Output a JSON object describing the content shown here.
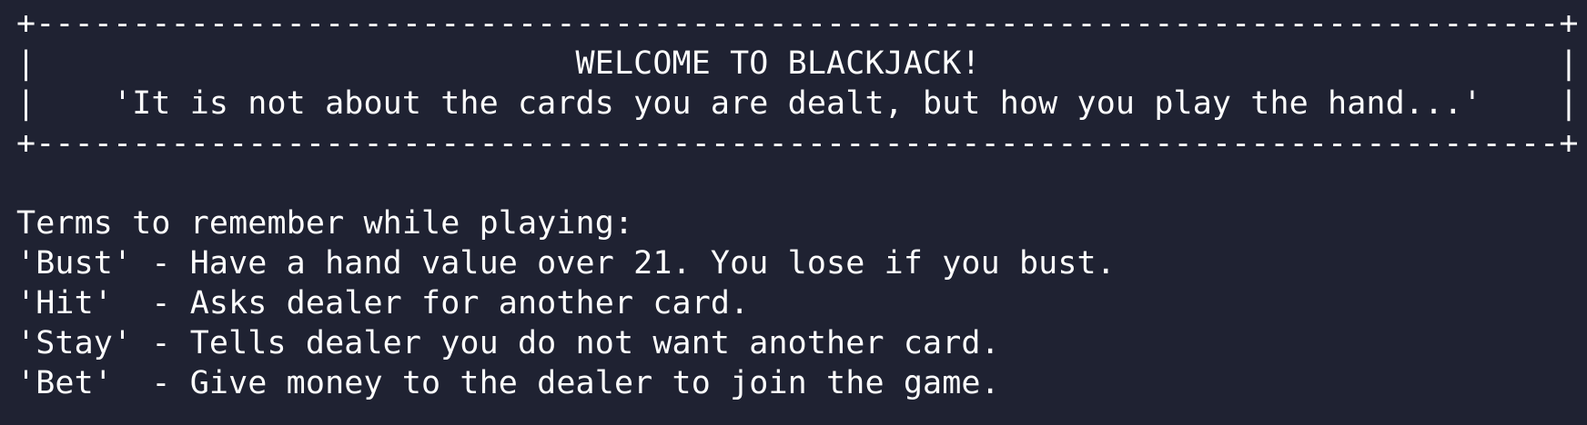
{
  "banner": {
    "border_top": "+-------------------------------------------------------------------------------+",
    "title_line": "|                            WELCOME TO BLACKJACK!                              |",
    "quote_line": "|    'It is not about the cards you are dealt, but how you play the hand...'    |",
    "border_bottom": "+-------------------------------------------------------------------------------+"
  },
  "terms": {
    "heading": "Terms to remember while playing:",
    "items": [
      "'Bust' - Have a hand value over 21. You lose if you bust.",
      "'Hit'  - Asks dealer for another card.",
      "'Stay' - Tells dealer you do not want another card.",
      "'Bet'  - Give money to the dealer to join the game."
    ]
  },
  "colors": {
    "background": "#1f2232",
    "text": "#ffffff"
  }
}
